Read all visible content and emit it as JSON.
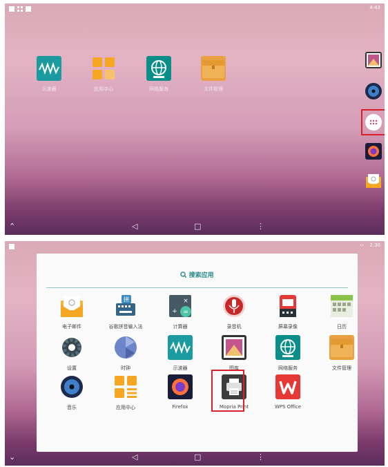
{
  "top_screen": {
    "time": "4:43",
    "home_apps": [
      {
        "label": "示波器",
        "icon": "oscilloscope-icon"
      },
      {
        "label": "应用中心",
        "icon": "app-center-icon"
      },
      {
        "label": "网络服务",
        "icon": "network-service-icon"
      },
      {
        "label": "文件管理",
        "icon": "file-manager-icon"
      }
    ],
    "dock": [
      "gallery-icon",
      "music-icon",
      "all-apps-icon",
      "firefox-icon",
      "email-icon"
    ]
  },
  "bottom_screen": {
    "time": "2:30",
    "search_label": "搜索应用",
    "apps": [
      {
        "label": "电子邮件",
        "icon": "email-icon"
      },
      {
        "label": "谷歌拼音输入法",
        "icon": "pinyin-keyboard-icon"
      },
      {
        "label": "计算器",
        "icon": "calculator-icon"
      },
      {
        "label": "录音机",
        "icon": "microphone-icon"
      },
      {
        "label": "屏幕录像",
        "icon": "screen-record-icon"
      },
      {
        "label": "日历",
        "icon": "calendar-icon"
      },
      {
        "label": "设置",
        "icon": "gear-icon"
      },
      {
        "label": "时钟",
        "icon": "clock-icon"
      },
      {
        "label": "示波器",
        "icon": "oscilloscope-icon"
      },
      {
        "label": "图库",
        "icon": "gallery-icon"
      },
      {
        "label": "网络服务",
        "icon": "network-service-icon"
      },
      {
        "label": "文件管理",
        "icon": "file-manager-icon"
      },
      {
        "label": "音乐",
        "icon": "music-icon"
      },
      {
        "label": "应用中心",
        "icon": "app-center-icon"
      },
      {
        "label": "Firefox",
        "icon": "firefox-icon"
      },
      {
        "label": "Mopria Print",
        "icon": "printer-icon"
      },
      {
        "label": "WPS Office",
        "icon": "wps-office-icon"
      }
    ]
  },
  "colors": {
    "highlight": "#d9202a",
    "search_accent": "#2f8d8a"
  }
}
